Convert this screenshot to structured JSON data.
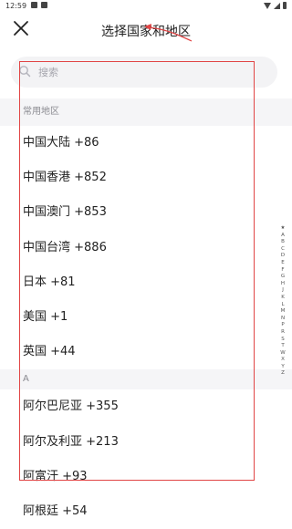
{
  "status_bar": {
    "time": "12:59"
  },
  "header": {
    "title": "选择国家和地区"
  },
  "search": {
    "placeholder": "搜索",
    "value": ""
  },
  "sections": [
    {
      "header": "常用地区",
      "items": [
        "中国大陆 +86",
        "中国香港 +852",
        "中国澳门 +853",
        "中国台湾 +886",
        "日本 +81",
        "美国 +1",
        "英国 +44"
      ]
    },
    {
      "header": "A",
      "items": [
        "阿尔巴尼亚 +355",
        "阿尔及利亚 +213",
        "阿富汗 +93",
        "阿根廷 +54"
      ]
    }
  ],
  "index_letters": [
    "★",
    "A",
    "B",
    "C",
    "D",
    "E",
    "F",
    "G",
    "H",
    "J",
    "K",
    "L",
    "M",
    "N",
    "P",
    "R",
    "S",
    "T",
    "W",
    "X",
    "Y",
    "Z"
  ],
  "colors": {
    "annotation": "#e14545",
    "section_bg": "#f5f5f7",
    "search_bg": "#f3f3f5"
  },
  "icons": {
    "close": "close-icon",
    "search": "search-icon"
  }
}
